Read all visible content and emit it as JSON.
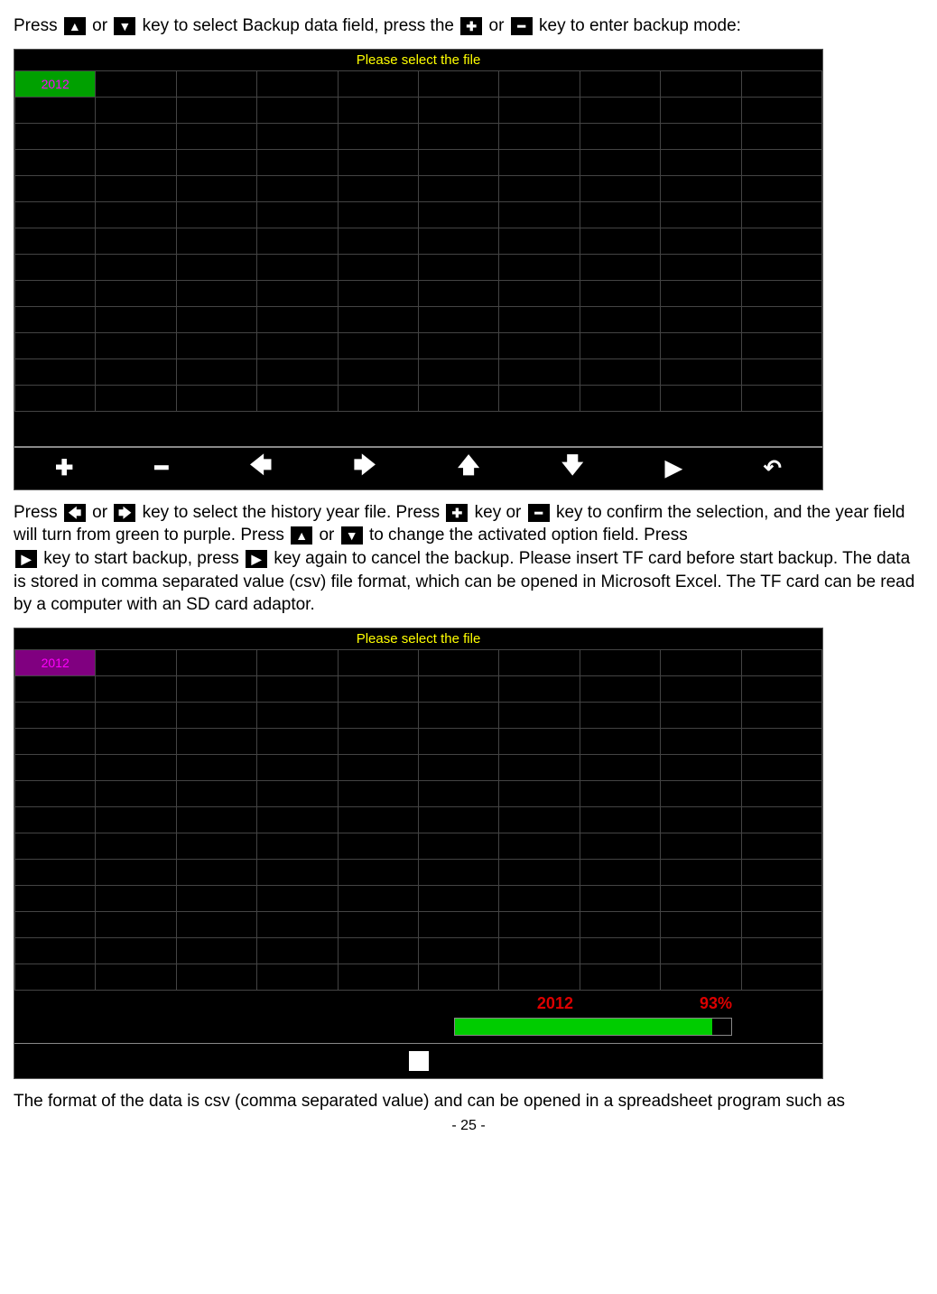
{
  "para1": {
    "t1": "Press ",
    "t2": " or ",
    "t3": " key to select Backup data field, press the ",
    "t4": " or ",
    "t5": " key to enter backup mode:"
  },
  "screen1": {
    "title": "Please select the file",
    "year": "2012"
  },
  "para2": {
    "t1": "Press ",
    "t2": " or ",
    "t3": " key to select the history year file. Press ",
    "t4": " key or ",
    "t5": " key to confirm the selection, and the year field will turn from green to purple.   Press ",
    "t6": " or ",
    "t7": " to change the activated option field. Press ",
    "t8": " key to start backup, press ",
    "t9": " key again to cancel the backup. Please insert TF card before start backup. The data is stored in comma separated value (csv) file format, which can be opened in Microsoft Excel. The TF card can be read by a computer with an SD card adaptor."
  },
  "screen2": {
    "title": "Please select the file",
    "year": "2012",
    "status_year": "2012",
    "status_pct": "93%"
  },
  "para3": "The format of the data is csv (comma separated value) and can be opened in a spreadsheet program such as",
  "footer": "- 25 -"
}
